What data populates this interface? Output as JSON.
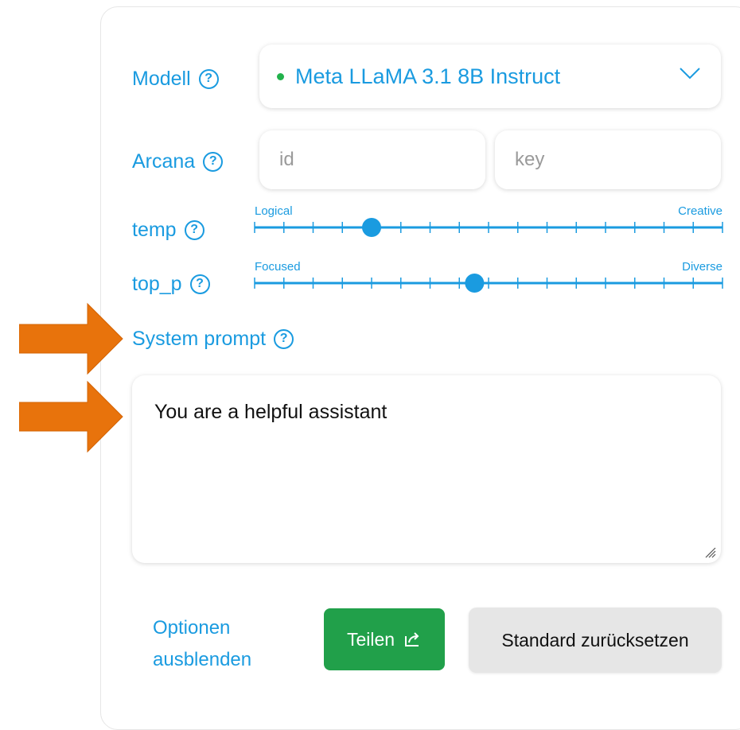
{
  "model": {
    "label": "Modell",
    "selected": "Meta LLaMA 3.1 8B Instruct",
    "status_color": "#22b24c"
  },
  "arcana": {
    "label": "Arcana",
    "id_placeholder": "id",
    "key_placeholder": "key"
  },
  "temp": {
    "label": "temp",
    "min_label": "Logical",
    "max_label": "Creative",
    "value_fraction": 0.25
  },
  "top_p": {
    "label": "top_p",
    "min_label": "Focused",
    "max_label": "Diverse",
    "value_fraction": 0.47
  },
  "system_prompt": {
    "label": "System prompt",
    "value": "You are a helpful assistant"
  },
  "footer": {
    "toggle_options_line1": "Optionen",
    "toggle_options_line2": "ausblenden",
    "share_label": "Teilen",
    "reset_label": "Standard zurücksetzen"
  },
  "help_glyph": "?",
  "colors": {
    "accent": "#1a9be0",
    "share_button": "#21a04a",
    "annotation_arrow": "#e8730c"
  }
}
